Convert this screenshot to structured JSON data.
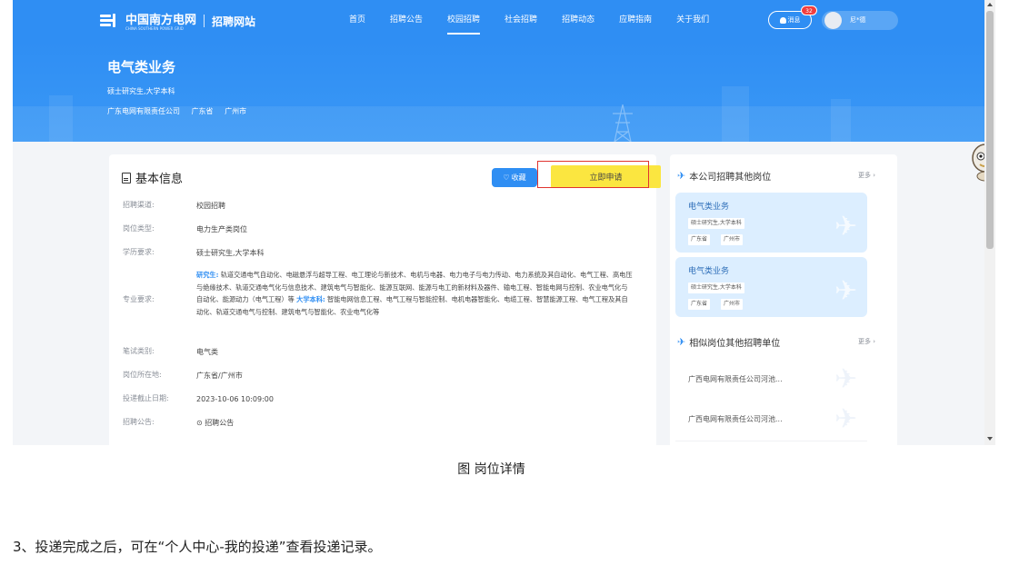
{
  "header": {
    "logo_text": "中国南方电网",
    "logo_subtext": "CHINA SOUTHERN POWER GRID",
    "site_name": "招聘网站",
    "nav": [
      {
        "label": "首页",
        "active": false
      },
      {
        "label": "招聘公告",
        "active": false
      },
      {
        "label": "校园招聘",
        "active": true
      },
      {
        "label": "社会招聘",
        "active": false
      },
      {
        "label": "招聘动态",
        "active": false
      },
      {
        "label": "应聘指南",
        "active": false
      },
      {
        "label": "关于我们",
        "active": false
      }
    ],
    "message_label": "消息",
    "message_count": "32",
    "user_name": "尼*德"
  },
  "banner": {
    "title": "电气类业务",
    "education": "硕士研究生,大学本科",
    "company": "广东电网有限责任公司",
    "province": "广东省",
    "city": "广州市"
  },
  "detail": {
    "section_title": "基本信息",
    "favorite_label": "收藏",
    "apply_label": "立即申请",
    "fields": [
      {
        "label": "招聘渠道:",
        "value": "校园招聘"
      },
      {
        "label": "岗位类型:",
        "value": "电力生产类岗位"
      },
      {
        "label": "学历要求:",
        "value": "硕士研究生,大学本科"
      },
      {
        "label": "专业要求:",
        "grad_label": "研究生:",
        "grad_value": "轨道交通电气自动化、电磁悬浮与超导工程、电工理论与新技术、电机与电器、电力电子与电力传动、电力系统及其自动化、电气工程、高电压与绝缘技术、轨道交通电气化与信息技术、建筑电气与智能化、能源互联网、能源与电工的新材料及器件、输电工程、智能电网与控制、农业电气化与自动化、能源动力（电气工程）等",
        "ug_label": "大学本科:",
        "ug_value": "智能电网信息工程、电气工程与智能控制、电机电器智能化、电缆工程、智慧能源工程、电气工程及其自动化、轨道交通电气与控制、建筑电气与智能化、农业电气化等"
      },
      {
        "label": "笔试类别:",
        "value": "电气类"
      },
      {
        "label": "岗位所在地:",
        "value": "广东省/广州市"
      },
      {
        "label": "投递截止日期:",
        "value": "2023-10-06 10:09:00"
      },
      {
        "label": "招聘公告:",
        "value": "⊙ 招聘公告"
      }
    ]
  },
  "sidebar": {
    "same_company_title": "本公司招聘其他岗位",
    "more_label": "更多 ›",
    "jobs": [
      {
        "title": "电气类业务",
        "education": "硕士研究生,大学本科",
        "province": "广东省",
        "city": "广州市"
      },
      {
        "title": "电气类业务",
        "education": "硕士研究生,大学本科",
        "province": "广东省",
        "city": "广州市"
      }
    ],
    "similar_title": "相似岗位其他招聘单位",
    "orgs": [
      {
        "name": "广西电网有限责任公司河池..."
      },
      {
        "name": "广西电网有限责任公司河池..."
      }
    ]
  },
  "caption": "图 岗位详情",
  "step_text": "3、投递完成之后，可在“个人中心-我的投递”查看投递记录。",
  "colors": {
    "brand_blue": "#2f8ef3",
    "apply_yellow": "#fbe640",
    "highlight_red": "#e0342f"
  }
}
